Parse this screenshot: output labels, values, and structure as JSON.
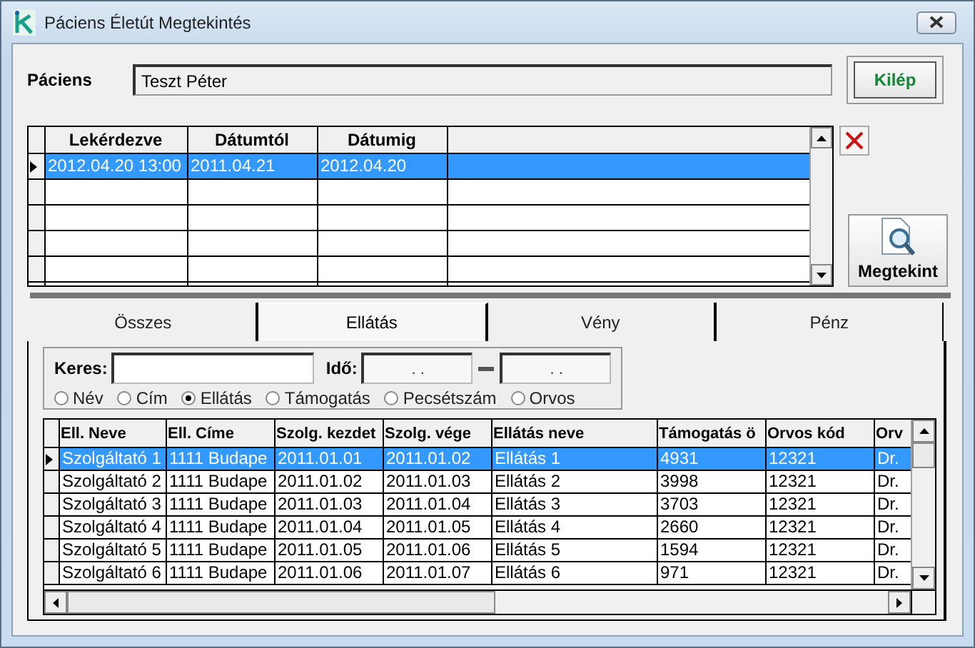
{
  "window": {
    "title": "Páciens Életút Megtekintés"
  },
  "patient": {
    "label": "Páciens",
    "value": "Teszt Péter"
  },
  "exit_button": "Kilép",
  "queries": {
    "columns": [
      "Lekérdezve",
      "Dátumtól",
      "Dátumig"
    ],
    "rows": [
      {
        "cells": [
          "2012.04.20 13:00",
          "2011.04.21",
          "2012.04.20"
        ],
        "selected": true
      }
    ]
  },
  "view_button": "Megtekint",
  "tabs": [
    {
      "label": "Összes",
      "selected": false
    },
    {
      "label": "Ellátás",
      "selected": true
    },
    {
      "label": "Vény",
      "selected": false
    },
    {
      "label": "Pénz",
      "selected": false
    }
  ],
  "search": {
    "label": "Keres:",
    "time_label": "Idő:",
    "time_from": ". .",
    "time_to": ". ."
  },
  "filters": [
    {
      "label": "Név",
      "selected": false
    },
    {
      "label": "Cím",
      "selected": false
    },
    {
      "label": "Ellátás",
      "selected": true
    },
    {
      "label": "Támogatás",
      "selected": false
    },
    {
      "label": "Pecsétszám",
      "selected": false
    },
    {
      "label": "Orvos",
      "selected": false
    }
  ],
  "services": {
    "columns": [
      "Ell. Neve",
      "Ell. Címe",
      "Szolg. kezdet",
      "Szolg. vége",
      "Ellátás neve",
      "Támogatás ö",
      "Orvos kód",
      "Orv"
    ],
    "rows": [
      {
        "cells": [
          "Szolgáltató 1",
          "1111 Budape",
          "2011.01.01",
          "2011.01.02",
          "Ellátás 1",
          "4931",
          "12321",
          "Dr."
        ],
        "selected": true
      },
      {
        "cells": [
          "Szolgáltató 2",
          "1111 Budape",
          "2011.01.02",
          "2011.01.03",
          "Ellátás 2",
          "3998",
          "12321",
          "Dr."
        ],
        "selected": false
      },
      {
        "cells": [
          "Szolgáltató 3",
          "1111 Budape",
          "2011.01.03",
          "2011.01.04",
          "Ellátás 3",
          "3703",
          "12321",
          "Dr."
        ],
        "selected": false
      },
      {
        "cells": [
          "Szolgáltató 4",
          "1111 Budape",
          "2011.01.04",
          "2011.01.05",
          "Ellátás 4",
          "2660",
          "12321",
          "Dr."
        ],
        "selected": false
      },
      {
        "cells": [
          "Szolgáltató 5",
          "1111 Budape",
          "2011.01.05",
          "2011.01.06",
          "Ellátás 5",
          "1594",
          "12321",
          "Dr."
        ],
        "selected": false
      },
      {
        "cells": [
          "Szolgáltató 6",
          "1111 Budape",
          "2011.01.06",
          "2011.01.07",
          "Ellátás 6",
          "971",
          "12321",
          "Dr."
        ],
        "selected": false
      }
    ]
  }
}
